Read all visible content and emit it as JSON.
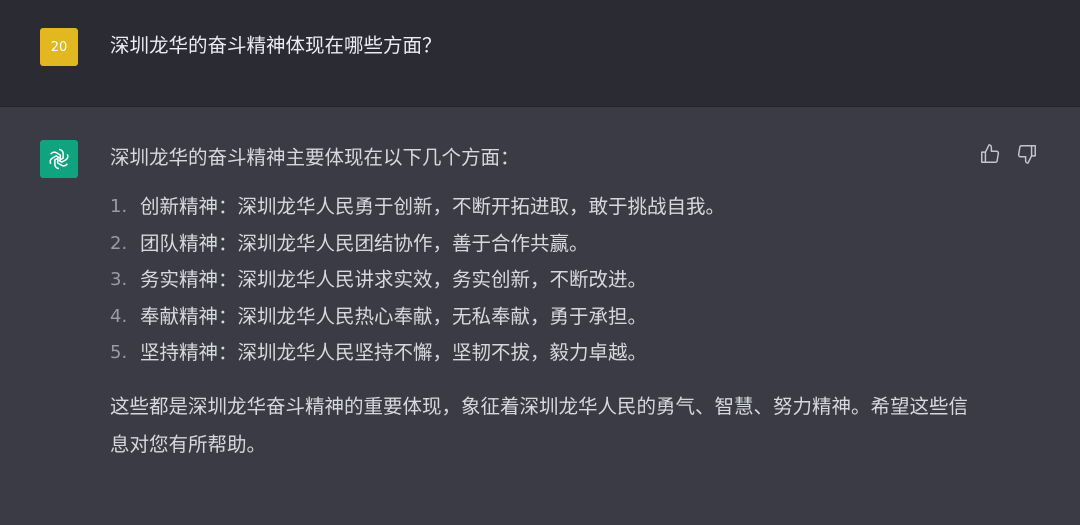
{
  "user_message": {
    "avatar_text": "20",
    "text": "深圳龙华的奋斗精神体现在哪些方面？"
  },
  "assistant_message": {
    "intro": "深圳龙华的奋斗精神主要体现在以下几个方面：",
    "items": [
      {
        "number": "1.",
        "text": "创新精神：深圳龙华人民勇于创新，不断开拓进取，敢于挑战自我。"
      },
      {
        "number": "2.",
        "text": "团队精神：深圳龙华人民团结协作，善于合作共赢。"
      },
      {
        "number": "3.",
        "text": "务实精神：深圳龙华人民讲求实效，务实创新，不断改进。"
      },
      {
        "number": "4.",
        "text": "奉献精神：深圳龙华人民热心奉献，无私奉献，勇于承担。"
      },
      {
        "number": "5.",
        "text": "坚持精神：深圳龙华人民坚持不懈，坚韧不拔，毅力卓越。"
      }
    ],
    "closing": "这些都是深圳龙华奋斗精神的重要体现，象征着深圳龙华人民的勇气、智慧、努力精神。希望这些信息对您有所帮助。"
  },
  "icons": {
    "bot_avatar": "openai-logo-icon",
    "feedback_up": "thumbs-up-icon",
    "feedback_down": "thumbs-down-icon"
  },
  "colors": {
    "user_avatar_bg": "#e1b81f",
    "bot_avatar_bg": "#10a37f"
  }
}
